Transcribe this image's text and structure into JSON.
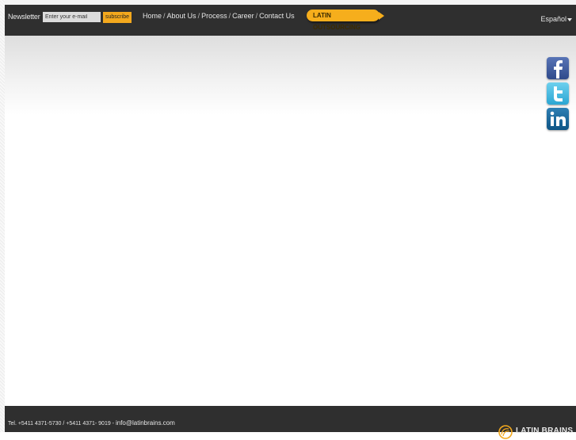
{
  "header": {
    "newsletter_label": "Newsletter",
    "email_placeholder": "Enter your e-mail",
    "subscribe_label": "subscribe",
    "nav": {
      "home": "Home",
      "about": "About Us",
      "process": "Process",
      "career": "Career",
      "contact": "Contact Us",
      "separator": "/"
    },
    "promo_label": "LATIN OUTSOURCING",
    "language": "Español"
  },
  "social": [
    {
      "name": "facebook",
      "icon": "facebook-icon"
    },
    {
      "name": "twitter",
      "icon": "twitter-icon"
    },
    {
      "name": "linkedin",
      "icon": "linkedin-icon"
    }
  ],
  "footer": {
    "tel_text": "Tel. +5411 4371-5730 / +5411 4371- 9019 - ",
    "email": "info@latinbrains.com",
    "logo_text": "LATIN BRAINS"
  },
  "colors": {
    "bar": "#2f2f2f",
    "accent": "#f3a81d"
  }
}
